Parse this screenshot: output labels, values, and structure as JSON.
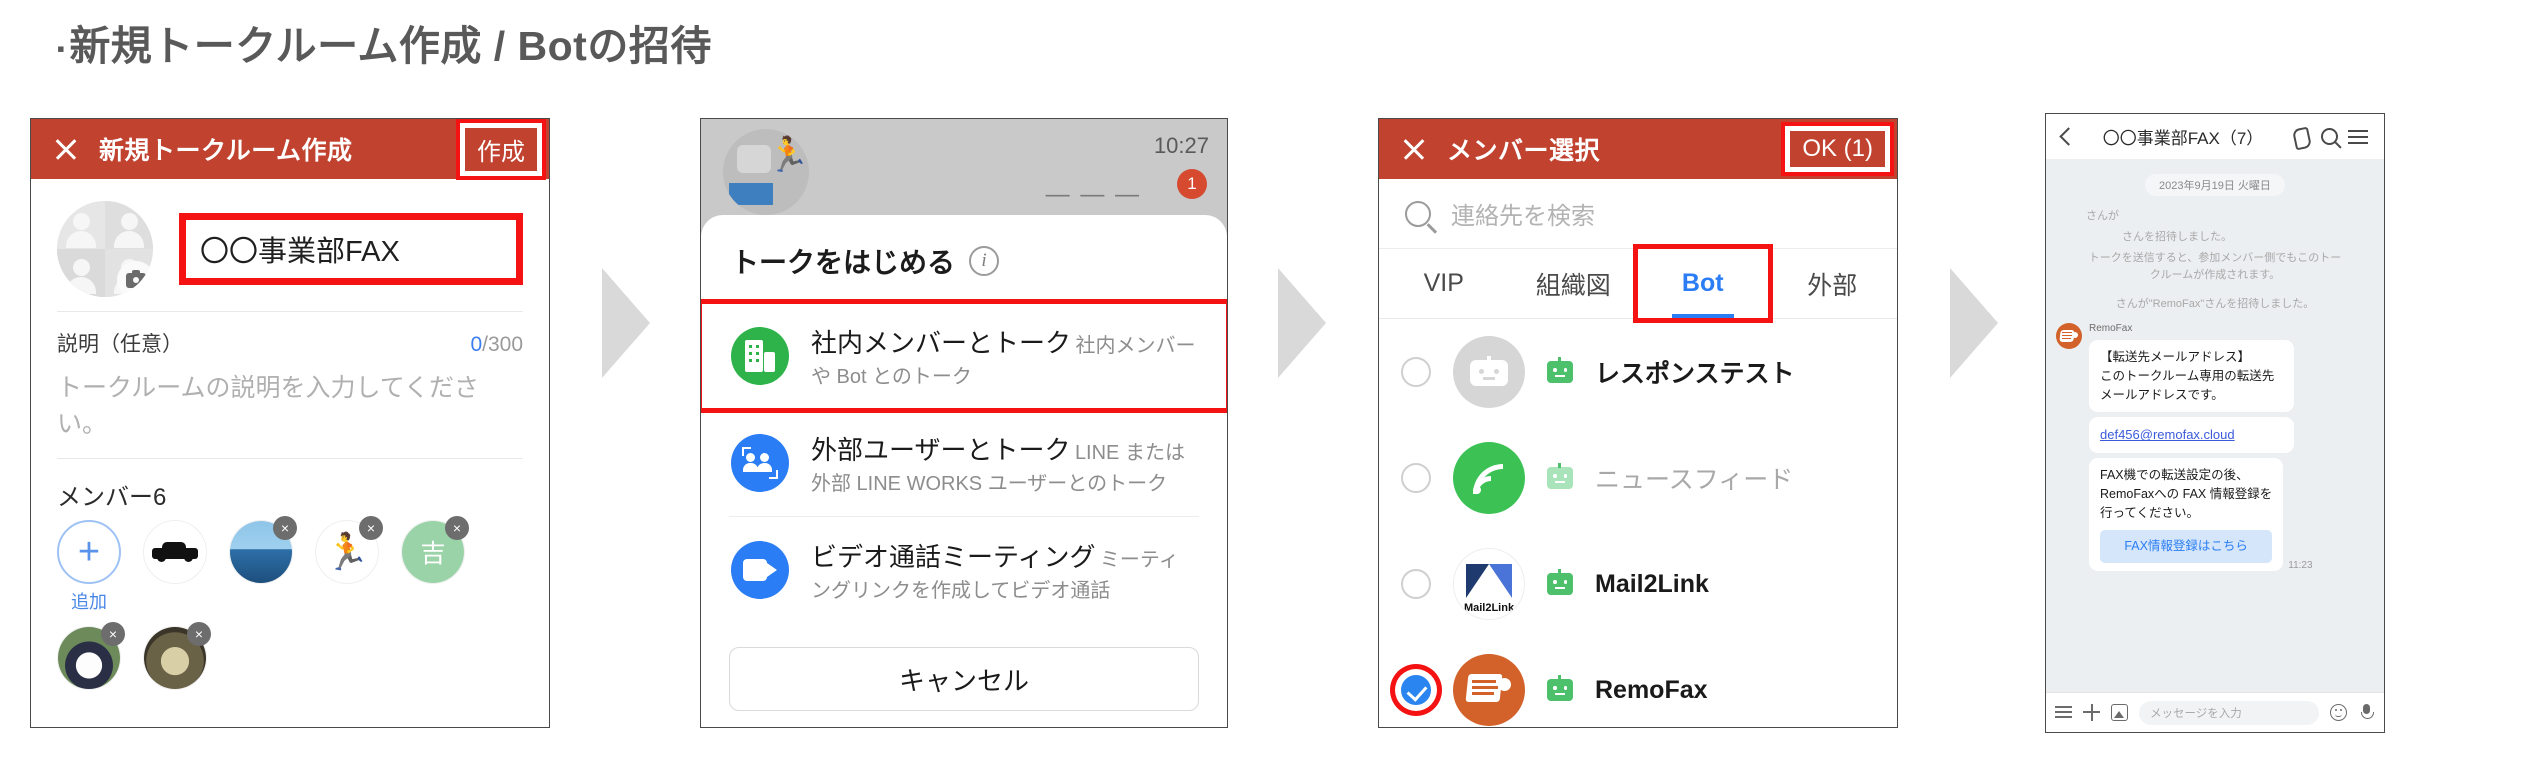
{
  "heading": {
    "bullet": "▪",
    "text": "新規トークルーム作成 / Botの招待"
  },
  "screen1": {
    "appbar": {
      "title": "新規トークルーム作成",
      "action": "作成",
      "close_icon": "close-icon"
    },
    "room_name": "〇〇事業部FAX",
    "description": {
      "label": "説明（任意）",
      "counter_current": "0",
      "counter_max": "/300",
      "placeholder": "トークルームの説明を入力してください。"
    },
    "members": {
      "label": "メンバー6",
      "add_label": "追加",
      "avatars": [
        {
          "name": "car-avatar",
          "remove": "×"
        },
        {
          "name": "seaside-avatar",
          "remove": "×"
        },
        {
          "name": "jumping-person-avatar",
          "glyph": "🏃",
          "remove": "×"
        },
        {
          "name": "initial-avatar",
          "glyph": "吉",
          "remove": "×"
        },
        {
          "name": "panda-avatar",
          "remove": "×"
        },
        {
          "name": "artwork-avatar",
          "remove": "×"
        }
      ]
    }
  },
  "screen2": {
    "status": {
      "time": "10:27",
      "badge": "1",
      "dashes": "— — —"
    },
    "sheet_title": "トークをはじめる",
    "options": [
      {
        "icon": "building-icon",
        "title": "社内メンバーとトーク",
        "subtitle": "社内メンバーや Bot とのトーク",
        "highlight": true
      },
      {
        "icon": "external-user-icon",
        "title": "外部ユーザーとトーク",
        "subtitle": "LINE または外部 LINE WORKS ユーザーとのトーク",
        "highlight": false
      },
      {
        "icon": "video-camera-icon",
        "title": "ビデオ通話ミーティング",
        "subtitle": "ミーティングリンクを作成してビデオ通話",
        "highlight": false
      }
    ],
    "cancel_label": "キャンセル"
  },
  "screen3": {
    "appbar": {
      "title": "メンバー選択",
      "action": "OK (1)",
      "close_icon": "close-icon"
    },
    "search_placeholder": "連絡先を検索",
    "tabs": [
      {
        "label": "VIP",
        "active": false
      },
      {
        "label": "組織図",
        "active": false
      },
      {
        "label": "Bot",
        "active": true
      },
      {
        "label": "外部",
        "active": false
      }
    ],
    "bots": [
      {
        "name": "レスポンステスト",
        "selected": false,
        "dimmed": false,
        "avatar": "robot-avatar"
      },
      {
        "name": "ニュースフィード",
        "selected": false,
        "dimmed": true,
        "avatar": "rss-avatar"
      },
      {
        "name": "Mail2Link",
        "selected": false,
        "dimmed": false,
        "avatar": "mail2link-avatar",
        "avatar_caption": "Mail2Link"
      },
      {
        "name": "RemoFax",
        "selected": true,
        "dimmed": false,
        "avatar": "remofax-avatar"
      }
    ]
  },
  "screen4": {
    "header": {
      "title": "〇〇事業部FAX（7）",
      "back_icon": "chevron-left-icon",
      "call_icon": "phone-icon",
      "search_icon": "search-icon",
      "menu_icon": "hamburger-menu-icon"
    },
    "date": "2023年9月19日 火曜日",
    "system_lines": [
      "さんが",
      "さんを招待しました。",
      "トークを送信すると、参加メンバー側でもこのトー\nクルームが作成されます。",
      "さんが\"RemoFax\"さんを招待しました。"
    ],
    "sender": "RemoFax",
    "messages": [
      {
        "text": "【転送先メールアドレス】\nこのトークルーム専用の転送先\nメールアドレスです。"
      },
      {
        "link": "def456@remofax.cloud"
      },
      {
        "text": "FAX機での転送設定の後、\nRemoFaxへの FAX 情報登録を\n行ってください。",
        "button": "FAX情報登録はこちら"
      }
    ],
    "timestamp": "11:23",
    "input_placeholder": "メッセージを入力"
  },
  "colors": {
    "brand_red": "#c0422f",
    "highlight_red": "#f41212",
    "accent_blue": "#2a7df4",
    "bot_green": "#4cc06a"
  }
}
